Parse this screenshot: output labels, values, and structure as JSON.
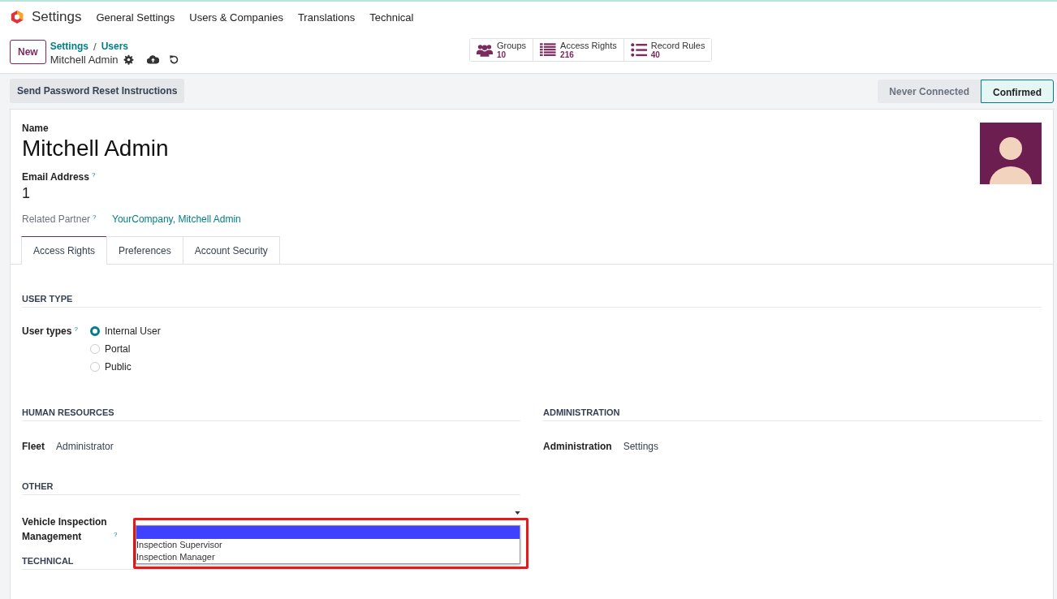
{
  "navbar": {
    "app": "Settings",
    "menu": [
      "General Settings",
      "Users & Companies",
      "Translations",
      "Technical"
    ]
  },
  "control_panel": {
    "new_button": "New",
    "breadcrumbs": [
      "Settings",
      "Users"
    ],
    "separator": "/",
    "record": "Mitchell Admin",
    "smart_buttons": [
      {
        "kind": "groups",
        "label": "Groups",
        "count": "10"
      },
      {
        "kind": "list",
        "label": "Access Rights",
        "count": "216"
      },
      {
        "kind": "bullets",
        "label": "Record Rules",
        "count": "40"
      }
    ]
  },
  "header": {
    "button": "Send Password Reset Instructions",
    "statuses": [
      {
        "label": "Never Connected",
        "selected": false
      },
      {
        "label": "Confirmed",
        "selected": true
      }
    ]
  },
  "form": {
    "name_label": "Name",
    "name": "Mitchell Admin",
    "email_label": "Email Address",
    "email_help": "?",
    "email": "1",
    "partner_label": "Related Partner",
    "partner_help": "?",
    "partner": "YourCompany, Mitchell Admin"
  },
  "tabs": [
    {
      "label": "Access Rights",
      "selected": true
    },
    {
      "label": "Preferences",
      "selected": false
    },
    {
      "label": "Account Security",
      "selected": false
    }
  ],
  "user_type": {
    "title": "USER TYPE",
    "label": "User types",
    "help": "?",
    "options": [
      {
        "label": "Internal User",
        "selected": true
      },
      {
        "label": "Portal",
        "selected": false
      },
      {
        "label": "Public",
        "selected": false
      }
    ]
  },
  "human_resources": {
    "title": "HUMAN RESOURCES",
    "label": "Fleet",
    "value": "Administrator"
  },
  "administration": {
    "title": "ADMINISTRATION",
    "label": "Administration",
    "value": "Settings"
  },
  "other": {
    "title": "OTHER",
    "label": "Vehicle Inspection Management",
    "help": "?",
    "dropdown": [
      {
        "selected": true
      },
      {
        "label": "Inspection Supervisor",
        "selected": false
      },
      {
        "label": "Inspection Manager",
        "selected": false
      }
    ]
  },
  "technical": {
    "title": "TECHNICAL"
  }
}
